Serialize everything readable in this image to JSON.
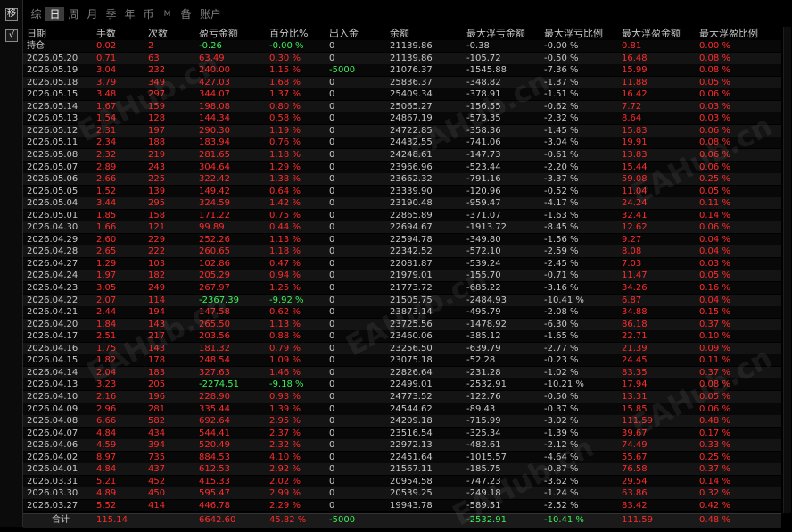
{
  "sidebar": {
    "top_label": "移",
    "check_label": "√"
  },
  "tabs": [
    {
      "label": "综",
      "active": false,
      "small": false
    },
    {
      "label": "日",
      "active": true,
      "small": false
    },
    {
      "label": "周",
      "active": false,
      "small": false
    },
    {
      "label": "月",
      "active": false,
      "small": false
    },
    {
      "label": "季",
      "active": false,
      "small": false
    },
    {
      "label": "年",
      "active": false,
      "small": false
    },
    {
      "label": "币",
      "active": false,
      "small": false
    },
    {
      "label": "M",
      "active": false,
      "small": true
    },
    {
      "label": "备",
      "active": false,
      "small": false
    },
    {
      "label": "账户",
      "active": false,
      "small": false
    }
  ],
  "watermark": "EAHub.cn",
  "colors": {
    "loss": "#ff2c2c",
    "gain": "#3cf05a",
    "text": "#c8c8c8",
    "bg": "#000000"
  },
  "table": {
    "headers": [
      "日期",
      "手数",
      "次数",
      "盈亏金额",
      "百分比%",
      "出入金",
      "余额",
      "最大浮亏金额",
      "最大浮亏比例",
      "最大浮盈金额",
      "最大浮盈比例"
    ],
    "rows": [
      [
        "持仓",
        "0.02",
        "2",
        "-0.26",
        "-0.00 %",
        "0",
        "21139.86",
        "-0.38",
        "-0.00 %",
        "0.81",
        "0.00 %"
      ],
      [
        "2026.05.20",
        "0.71",
        "63",
        "63.49",
        "0.30 %",
        "0",
        "21139.86",
        "-105.72",
        "-0.50 %",
        "16.48",
        "0.08 %"
      ],
      [
        "2026.05.19",
        "3.04",
        "232",
        "240.00",
        "1.15 %",
        "-5000",
        "21076.37",
        "-1545.88",
        "-7.36 %",
        "15.99",
        "0.08 %"
      ],
      [
        "2026.05.18",
        "3.79",
        "349",
        "427.03",
        "1.68 %",
        "0",
        "25836.37",
        "-348.82",
        "-1.37 %",
        "11.88",
        "0.05 %"
      ],
      [
        "2026.05.15",
        "3.48",
        "297",
        "344.07",
        "1.37 %",
        "0",
        "25409.34",
        "-378.91",
        "-1.51 %",
        "16.42",
        "0.06 %"
      ],
      [
        "2026.05.14",
        "1.67",
        "159",
        "198.08",
        "0.80 %",
        "0",
        "25065.27",
        "-156.55",
        "-0.62 %",
        "7.72",
        "0.03 %"
      ],
      [
        "2026.05.13",
        "1.54",
        "128",
        "144.34",
        "0.58 %",
        "0",
        "24867.19",
        "-573.35",
        "-2.32 %",
        "8.64",
        "0.03 %"
      ],
      [
        "2026.05.12",
        "2.31",
        "197",
        "290.30",
        "1.19 %",
        "0",
        "24722.85",
        "-358.36",
        "-1.45 %",
        "15.83",
        "0.06 %"
      ],
      [
        "2026.05.11",
        "2.34",
        "188",
        "183.94",
        "0.76 %",
        "0",
        "24432.55",
        "-741.06",
        "-3.04 %",
        "19.91",
        "0.08 %"
      ],
      [
        "2026.05.08",
        "2.32",
        "219",
        "281.65",
        "1.18 %",
        "0",
        "24248.61",
        "-147.73",
        "-0.61 %",
        "13.83",
        "0.06 %"
      ],
      [
        "2026.05.07",
        "2.89",
        "243",
        "304.64",
        "1.29 %",
        "0",
        "23966.96",
        "-523.44",
        "-2.20 %",
        "15.44",
        "0.06 %"
      ],
      [
        "2026.05.06",
        "2.66",
        "225",
        "322.42",
        "1.38 %",
        "0",
        "23662.32",
        "-791.16",
        "-3.37 %",
        "59.08",
        "0.25 %"
      ],
      [
        "2026.05.05",
        "1.52",
        "139",
        "149.42",
        "0.64 %",
        "0",
        "23339.90",
        "-120.96",
        "-0.52 %",
        "11.04",
        "0.05 %"
      ],
      [
        "2026.05.04",
        "3.44",
        "295",
        "324.59",
        "1.42 %",
        "0",
        "23190.48",
        "-959.47",
        "-4.17 %",
        "24.24",
        "0.11 %"
      ],
      [
        "2026.05.01",
        "1.85",
        "158",
        "171.22",
        "0.75 %",
        "0",
        "22865.89",
        "-371.07",
        "-1.63 %",
        "32.41",
        "0.14 %"
      ],
      [
        "2026.04.30",
        "1.66",
        "121",
        "99.89",
        "0.44 %",
        "0",
        "22694.67",
        "-1913.72",
        "-8.45 %",
        "12.62",
        "0.06 %"
      ],
      [
        "2026.04.29",
        "2.60",
        "229",
        "252.26",
        "1.13 %",
        "0",
        "22594.78",
        "-349.80",
        "-1.56 %",
        "9.27",
        "0.04 %"
      ],
      [
        "2026.04.28",
        "2.65",
        "222",
        "260.65",
        "1.18 %",
        "0",
        "22342.52",
        "-572.10",
        "-2.59 %",
        "8.08",
        "0.04 %"
      ],
      [
        "2026.04.27",
        "1.29",
        "103",
        "102.86",
        "0.47 %",
        "0",
        "22081.87",
        "-539.24",
        "-2.45 %",
        "7.03",
        "0.03 %"
      ],
      [
        "2026.04.24",
        "1.97",
        "182",
        "205.29",
        "0.94 %",
        "0",
        "21979.01",
        "-155.70",
        "-0.71 %",
        "11.47",
        "0.05 %"
      ],
      [
        "2026.04.23",
        "3.05",
        "249",
        "267.97",
        "1.25 %",
        "0",
        "21773.72",
        "-685.22",
        "-3.16 %",
        "34.26",
        "0.16 %"
      ],
      [
        "2026.04.22",
        "2.07",
        "114",
        "-2367.39",
        "-9.92 %",
        "0",
        "21505.75",
        "-2484.93",
        "-10.41 %",
        "6.87",
        "0.04 %"
      ],
      [
        "2026.04.21",
        "2.44",
        "194",
        "147.58",
        "0.62 %",
        "0",
        "23873.14",
        "-495.79",
        "-2.08 %",
        "34.88",
        "0.15 %"
      ],
      [
        "2026.04.20",
        "1.84",
        "143",
        "265.50",
        "1.13 %",
        "0",
        "23725.56",
        "-1478.92",
        "-6.30 %",
        "86.18",
        "0.37 %"
      ],
      [
        "2026.04.17",
        "2.51",
        "217",
        "203.56",
        "0.88 %",
        "0",
        "23460.06",
        "-385.12",
        "-1.65 %",
        "22.71",
        "0.10 %"
      ],
      [
        "2026.04.16",
        "1.75",
        "143",
        "181.32",
        "0.79 %",
        "0",
        "23256.50",
        "-639.79",
        "-2.77 %",
        "21.39",
        "0.09 %"
      ],
      [
        "2026.04.15",
        "1.82",
        "178",
        "248.54",
        "1.09 %",
        "0",
        "23075.18",
        "-52.28",
        "-0.23 %",
        "24.45",
        "0.11 %"
      ],
      [
        "2026.04.14",
        "2.04",
        "183",
        "327.63",
        "1.46 %",
        "0",
        "22826.64",
        "-231.28",
        "-1.02 %",
        "83.35",
        "0.37 %"
      ],
      [
        "2026.04.13",
        "3.23",
        "205",
        "-2274.51",
        "-9.18 %",
        "0",
        "22499.01",
        "-2532.91",
        "-10.21 %",
        "17.94",
        "0.08 %"
      ],
      [
        "2026.04.10",
        "2.16",
        "196",
        "228.90",
        "0.93 %",
        "0",
        "24773.52",
        "-122.76",
        "-0.50 %",
        "13.31",
        "0.05 %"
      ],
      [
        "2026.04.09",
        "2.96",
        "281",
        "335.44",
        "1.39 %",
        "0",
        "24544.62",
        "-89.43",
        "-0.37 %",
        "15.85",
        "0.06 %"
      ],
      [
        "2026.04.08",
        "6.66",
        "582",
        "692.64",
        "2.95 %",
        "0",
        "24209.18",
        "-715.99",
        "-3.02 %",
        "111.59",
        "0.48 %"
      ],
      [
        "2026.04.07",
        "4.84",
        "434",
        "544.41",
        "2.37 %",
        "0",
        "23516.54",
        "-325.34",
        "-1.39 %",
        "39.67",
        "0.17 %"
      ],
      [
        "2026.04.06",
        "4.59",
        "394",
        "520.49",
        "2.32 %",
        "0",
        "22972.13",
        "-482.61",
        "-2.12 %",
        "74.49",
        "0.33 %"
      ],
      [
        "2026.04.02",
        "8.97",
        "735",
        "884.53",
        "4.10 %",
        "0",
        "22451.64",
        "-1015.57",
        "-4.64 %",
        "55.67",
        "0.25 %"
      ],
      [
        "2026.04.01",
        "4.84",
        "437",
        "612.53",
        "2.92 %",
        "0",
        "21567.11",
        "-185.75",
        "-0.87 %",
        "76.58",
        "0.37 %"
      ],
      [
        "2026.03.31",
        "5.21",
        "452",
        "415.33",
        "2.02 %",
        "0",
        "20954.58",
        "-747.23",
        "-3.62 %",
        "29.54",
        "0.14 %"
      ],
      [
        "2026.03.30",
        "4.89",
        "450",
        "595.47",
        "2.99 %",
        "0",
        "20539.25",
        "-249.18",
        "-1.24 %",
        "63.86",
        "0.32 %"
      ],
      [
        "2026.03.27",
        "5.52",
        "414",
        "446.78",
        "2.29 %",
        "0",
        "19943.78",
        "-589.51",
        "-2.52 %",
        "83.42",
        "0.42 %"
      ]
    ],
    "totals": [
      "合计",
      "115.14",
      "",
      "6642.60",
      "45.82 %",
      "-5000",
      "",
      "-2532.91",
      "-10.41 %",
      "111.59",
      "0.48 %"
    ]
  }
}
